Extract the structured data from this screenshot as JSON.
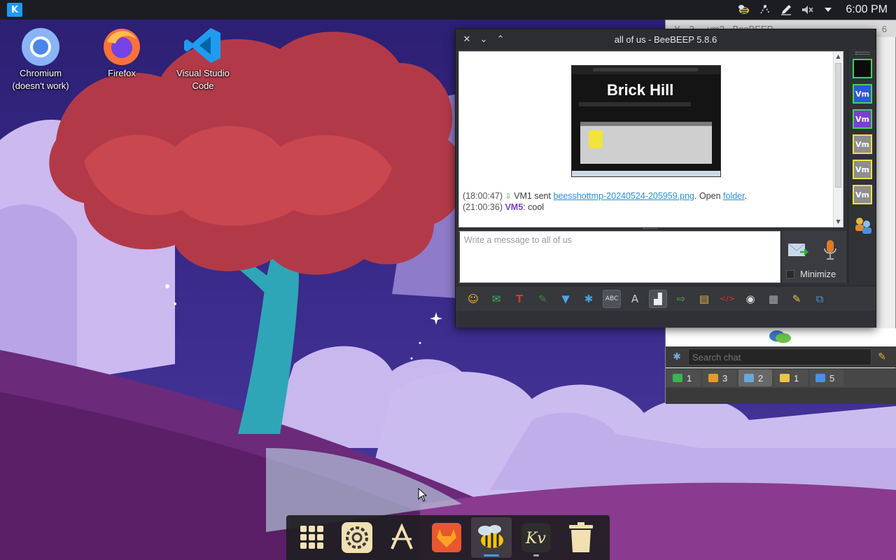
{
  "desktop": {
    "icons": [
      {
        "label_line1": "Chromium",
        "label_line2": "(doesn't work)"
      },
      {
        "label_line1": "Firefox",
        "label_line2": ""
      },
      {
        "label_line1": "Visual Studio",
        "label_line2": "Code"
      }
    ]
  },
  "top_panel": {
    "kde_icon": "kde-logo-icon",
    "tray_icons": [
      "beebeep-tray-icon",
      "network-icon",
      "pen-icon",
      "speaker-muted-icon",
      "chevron-down-icon"
    ],
    "clock": "6:00 PM"
  },
  "background_window": {
    "title": "Y...  2...  -vm2 - BeeBEEP",
    "title_suffix": "6",
    "search_placeholder": "Search chat",
    "tabs": [
      {
        "icon": "chat-icon",
        "count": "1"
      },
      {
        "icon": "group-icon",
        "count": "3"
      },
      {
        "icon": "chats-icon",
        "count": "2"
      },
      {
        "icon": "users-icon",
        "count": "1"
      },
      {
        "icon": "shared-files-icon",
        "count": "5"
      }
    ]
  },
  "chat_window": {
    "title": "all of us - BeeBEEP 5.8.6",
    "screenshot_heading": "Brick Hill",
    "messages": {
      "m1_time": "(18:00:47)",
      "m1_user": "VM1",
      "m1_sent": " sent ",
      "m1_file": "beesshottmp-20240524-205959.png",
      "m1_open": ". Open ",
      "m1_folder": "folder",
      "m1_end": ".",
      "m2_time": "(21:00:36)",
      "m2_user": "VM5",
      "m2_text": ": cool"
    },
    "compose_placeholder": "Write a message to all of us",
    "minimize_label": "Minimize",
    "side_users": [
      "Vm",
      "Vm",
      "Vm",
      "Vm",
      "Vm"
    ],
    "toolbar_icons": [
      "emoticon-icon",
      "email-icon",
      "text-color-icon",
      "highlight-color-icon",
      "filter-icon",
      "settings-icon",
      "spellcheck-icon",
      "font-icon",
      "compact-icon",
      "send-file-icon",
      "send-folder-icon",
      "html-icon",
      "screenshot-icon",
      "clear-icon",
      "save-icon",
      "detach-icon"
    ]
  },
  "dock": {
    "items": [
      "app-launcher-icon",
      "system-settings-icon",
      "discover-icon",
      "gitlab-icon",
      "beebeep-icon",
      "kvantum-icon",
      "trash-icon"
    ]
  },
  "colors": {
    "accent": "#3d9cf0",
    "link": "#2b8fd6",
    "vm5_name": "#7a3fc7",
    "panel": "#1b1d22"
  }
}
